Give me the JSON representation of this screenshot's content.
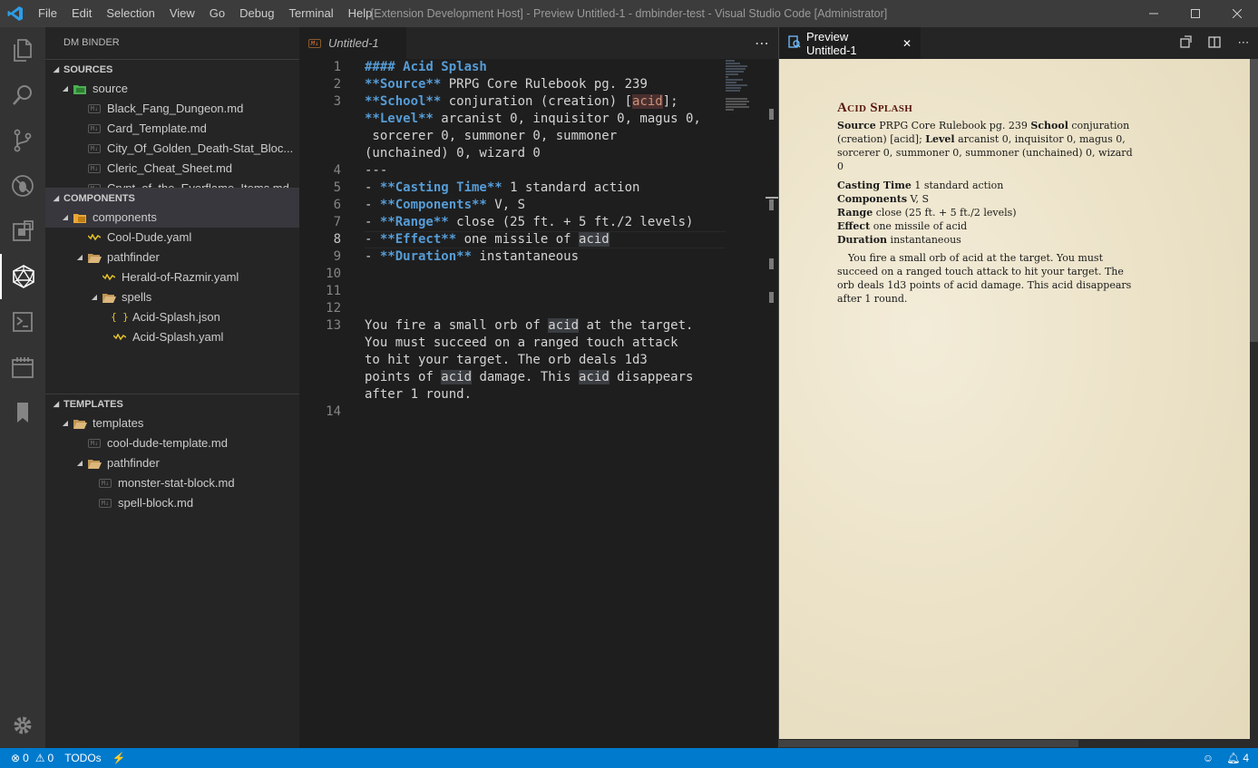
{
  "window": {
    "title": "[Extension Development Host] - Preview Untitled-1 - dmbinder-test - Visual Studio Code [Administrator]",
    "menu": [
      "File",
      "Edit",
      "Selection",
      "View",
      "Go",
      "Debug",
      "Terminal",
      "Help"
    ]
  },
  "activity_bar": [
    "explorer-icon",
    "search-icon",
    "source-control-icon",
    "debug-icon",
    "extensions-icon",
    "d20-icon",
    "terminal-icon",
    "calendar-icon",
    "bookmark-icon",
    "gear-icon"
  ],
  "sidebar": {
    "title": "DM BINDER",
    "sources": {
      "header": "SOURCES",
      "root": "source",
      "items": [
        "Black_Fang_Dungeon.md",
        "Card_Template.md",
        "City_Of_Golden_Death-Stat_Bloc...",
        "Cleric_Cheat_Sheet.md",
        "Crypt_of_the_Everflame_Items.md"
      ]
    },
    "components": {
      "header": "COMPONENTS",
      "root": "components",
      "cool_dude": "Cool-Dude.yaml",
      "pathfinder": "pathfinder",
      "herald": "Herald-of-Razmir.yaml",
      "spells": "spells",
      "acid_json": "Acid-Splash.json",
      "acid_yaml": "Acid-Splash.yaml"
    },
    "templates": {
      "header": "TEMPLATES",
      "root": "templates",
      "cool_dude_template": "cool-dude-template.md",
      "pathfinder": "pathfinder",
      "monster": "monster-stat-block.md",
      "spell": "spell-block.md"
    }
  },
  "editor": {
    "tab": "Untitled-1",
    "line_numbers": [
      "1",
      "2",
      "3",
      "4",
      "5",
      "6",
      "7",
      "8",
      "9",
      "10",
      "11",
      "12",
      "13",
      "14"
    ],
    "lines": {
      "l1": "#### Acid Splash",
      "l2_kw": "**Source**",
      "l2_rest": " PRPG Core Rulebook pg. 239",
      "l3_kw": "**School**",
      "l3_rest": " conjuration (creation) [",
      "l3_acid": "acid",
      "l3_end": "];",
      "l3b_kw": "**Level**",
      "l3b_rest": " arcanist 0, inquisitor 0, magus 0,",
      "l3c": " sorcerer 0, summoner 0, summoner",
      "l3d": "(unchained) 0, wizard 0",
      "l4": "---",
      "l5_dash": "- ",
      "l5_kw": "**Casting Time**",
      "l5_rest": " 1 standard action",
      "l6_dash": "- ",
      "l6_kw": "**Components**",
      "l6_rest": " V, S",
      "l7_dash": "- ",
      "l7_kw": "**Range**",
      "l7_rest": " close (25 ft. + 5 ft./2 levels)",
      "l8_dash": "- ",
      "l8_kw": "**Effect**",
      "l8_rest": " one missile of ",
      "l8_acid": "acid",
      "l9_dash": "- ",
      "l9_kw": "**Duration**",
      "l9_rest": " instantaneous",
      "l13a_1": "You fire a small orb of ",
      "l13a_acid": "acid",
      "l13a_2": " at the target.",
      "l13b": "You must succeed on a ranged touch attack",
      "l13c": "to hit your target. The orb deals 1d3",
      "l13d_1": "points of ",
      "l13d_acid1": "acid",
      "l13d_2": " damage. This ",
      "l13d_acid2": "acid",
      "l13d_3": " disappears",
      "l13e": "after 1 round."
    }
  },
  "preview": {
    "tab": "Preview Untitled-1",
    "title": "Acid Splash",
    "source_label": "Source",
    "source_val": " PRPG Core Rulebook pg. 239 ",
    "school_label": "School",
    "school_val": " conjuration (creation) [acid]; ",
    "level_label": "Level",
    "level_val": " arcanist 0, inquisitor 0, magus 0, sorcerer 0, summoner 0, summoner (unchained) 0, wizard 0",
    "casting_label": "Casting Time",
    "casting_val": " 1 standard action",
    "components_label": "Components",
    "components_val": " V, S",
    "range_label": "Range",
    "range_val": " close (25 ft. + 5 ft./2 levels)",
    "effect_label": "Effect",
    "effect_val": " one missile of acid",
    "duration_label": "Duration",
    "duration_val": " instantaneous",
    "description": "You fire a small orb of acid at the target. You must succeed on a ranged touch attack to hit your target. The orb deals 1d3 points of acid damage. This acid disappears after 1 round."
  },
  "status": {
    "errors": "0",
    "warnings": "0",
    "todos": "TODOs",
    "notifications": "4"
  },
  "colors": {
    "accent": "#007acc",
    "keyword": "#569cd6",
    "preview_title": "#58180d"
  }
}
